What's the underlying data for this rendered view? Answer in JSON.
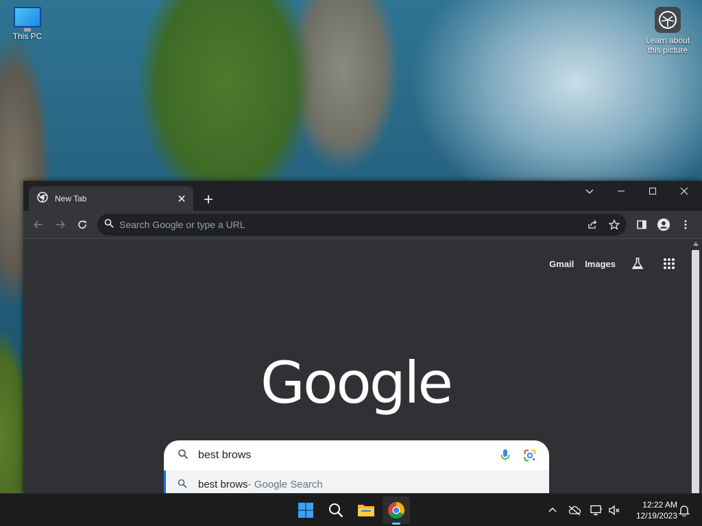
{
  "desktop": {
    "icons": [
      {
        "label": "This PC",
        "icon": "monitor-icon"
      },
      {
        "label": "Learn about this picture",
        "icon": "camera-lens-icon"
      }
    ]
  },
  "browser": {
    "tab": {
      "title": "New Tab",
      "icon": "chrome-icon",
      "close_icon": "close-icon"
    },
    "new_tab_icon": "plus-icon",
    "window_controls": [
      "chevron-down-icon",
      "minimize-icon",
      "maximize-icon",
      "close-icon"
    ],
    "omnibox": {
      "placeholder": "Search Google or type a URL"
    },
    "toolbar_icons": [
      "back-arrow-icon",
      "forward-arrow-icon",
      "reload-icon",
      "share-icon",
      "star-icon",
      "side-panel-icon",
      "profile-icon",
      "kebab-menu-icon"
    ]
  },
  "page": {
    "links": {
      "gmail": "Gmail",
      "images": "Images"
    },
    "labs_icon": "flask-icon",
    "apps_icon": "grid-icon",
    "logo": "Google",
    "search": {
      "query": "best brows",
      "suggestion_text": "best brows",
      "suggestion_suffix": " - Google Search"
    }
  },
  "taskbar": {
    "apps": [
      "windows-start-icon",
      "search-icon",
      "file-explorer-icon",
      "chrome-icon"
    ],
    "tray": [
      "chevron-up-icon",
      "cloud-offline-icon",
      "network-icon",
      "volume-muted-icon",
      "bell-icon"
    ],
    "time": "12:22 AM",
    "date": "12/19/2023"
  },
  "colors": {
    "browser_bg": "#202124",
    "toolbar_bg": "#35363a",
    "content_bg": "#303134",
    "accent": "#1a73e8",
    "taskbar_bg": "#1c1c1c"
  }
}
